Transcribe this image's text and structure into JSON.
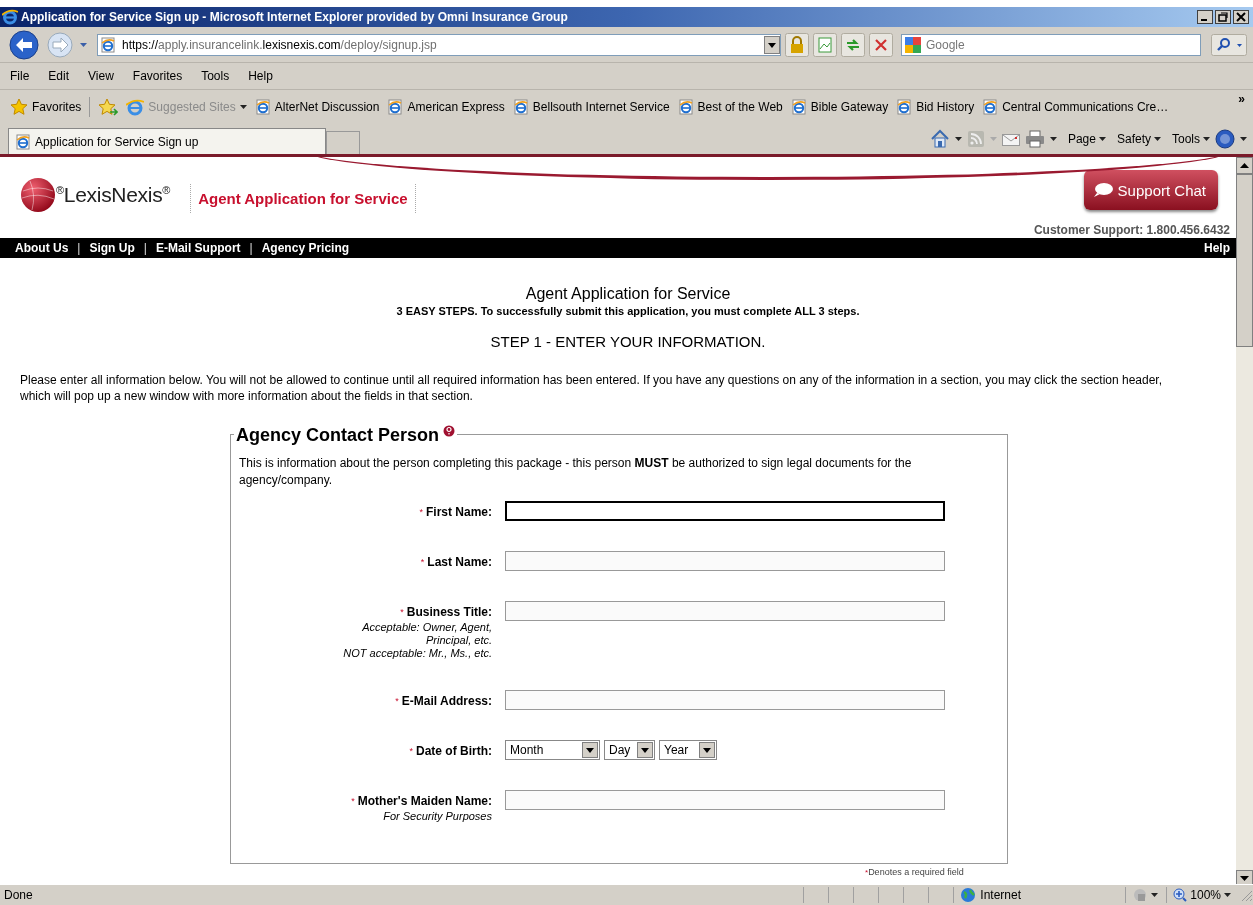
{
  "window": {
    "title": "Application for Service Sign up - Microsoft Internet Explorer provided by Omni Insurance Group"
  },
  "address_bar": {
    "url_parts": [
      {
        "text": "https://",
        "emphasis": true
      },
      {
        "text": "apply.insurancelink.",
        "emphasis": false
      },
      {
        "text": "lexisnexis.com",
        "emphasis": true
      },
      {
        "text": "/deploy/signup.jsp",
        "emphasis": false
      }
    ]
  },
  "search": {
    "placeholder": "Google"
  },
  "menu": [
    "File",
    "Edit",
    "View",
    "Favorites",
    "Tools",
    "Help"
  ],
  "favorites_bar": {
    "label": "Favorites",
    "more": "»",
    "items": [
      {
        "label": "Suggested Sites",
        "kind": "dropdown"
      },
      {
        "label": "AlterNet Discussion",
        "kind": "link"
      },
      {
        "label": "American Express",
        "kind": "link"
      },
      {
        "label": "Bellsouth Internet Service",
        "kind": "link"
      },
      {
        "label": "Best of the Web",
        "kind": "link"
      },
      {
        "label": "Bible Gateway",
        "kind": "link"
      },
      {
        "label": "Bid History",
        "kind": "link"
      },
      {
        "label": "Central Communications Cre…",
        "kind": "link"
      }
    ]
  },
  "tabs": [
    {
      "label": "Application for Service Sign up",
      "selected": true
    }
  ],
  "command_bar": [
    "Page",
    "Safety",
    "Tools"
  ],
  "site": {
    "logo": "$^{®}$LexisNexis$^{®}$",
    "header_title": "Agent Application for Service",
    "support_button": "Support Chat",
    "customer_support": "Customer Support: 1.800.456.6432",
    "nav": [
      {
        "label": "About Us",
        "kind": "link"
      },
      {
        "label": "|",
        "kind": "separator"
      },
      {
        "label": "Sign Up",
        "kind": "link"
      },
      {
        "label": "|",
        "kind": "separator"
      },
      {
        "label": "E-Mail Support",
        "kind": "link"
      },
      {
        "label": "|",
        "kind": "separator"
      },
      {
        "label": "Agency Pricing",
        "kind": "link"
      }
    ],
    "nav_right": "Help"
  },
  "page": {
    "title": "Agent Application for Service",
    "subtitle": "3 EASY STEPS. To successfully submit this application, you must complete ALL 3 steps.",
    "step": "STEP 1 - ENTER YOUR INFORMATION.",
    "intro": "Please enter all information below. You will not be allowed to continue until all required information has been entered. If you have any questions on any of the information in a section, you may click the section header, which will pop up a new window with more information about the fields in that section."
  },
  "section": {
    "legend": "Agency Contact Person",
    "description": "This is information about the person completing this package - this person **MUST** be authorized to sign legal documents for the agency/company.",
    "required_mark": "*",
    "fields": [
      {
        "label": "First Name:",
        "kind": "text",
        "required": true,
        "focused": true
      },
      {
        "label": "Last Name:",
        "kind": "text",
        "required": true,
        "focused": false
      },
      {
        "label": "Business Title:",
        "kind": "text",
        "required": true,
        "focused": false,
        "hints": [
          "Acceptable: Owner, Agent, Principal, etc.",
          "NOT acceptable: Mr., Ms., etc."
        ]
      },
      {
        "label": "E-Mail Address:",
        "kind": "text",
        "required": true,
        "focused": false
      },
      {
        "label": "Date of Birth:",
        "kind": "date",
        "required": true,
        "selects": [
          "Month",
          "Day",
          "Year"
        ]
      },
      {
        "label": "Mother's Maiden Name:",
        "kind": "text",
        "required": true,
        "focused": false,
        "hints": [
          "For Security Purposes"
        ]
      }
    ],
    "required_note": "Denotes a required field"
  },
  "status_bar": {
    "text": "Done",
    "zone": "Internet",
    "zoom": "100%"
  }
}
